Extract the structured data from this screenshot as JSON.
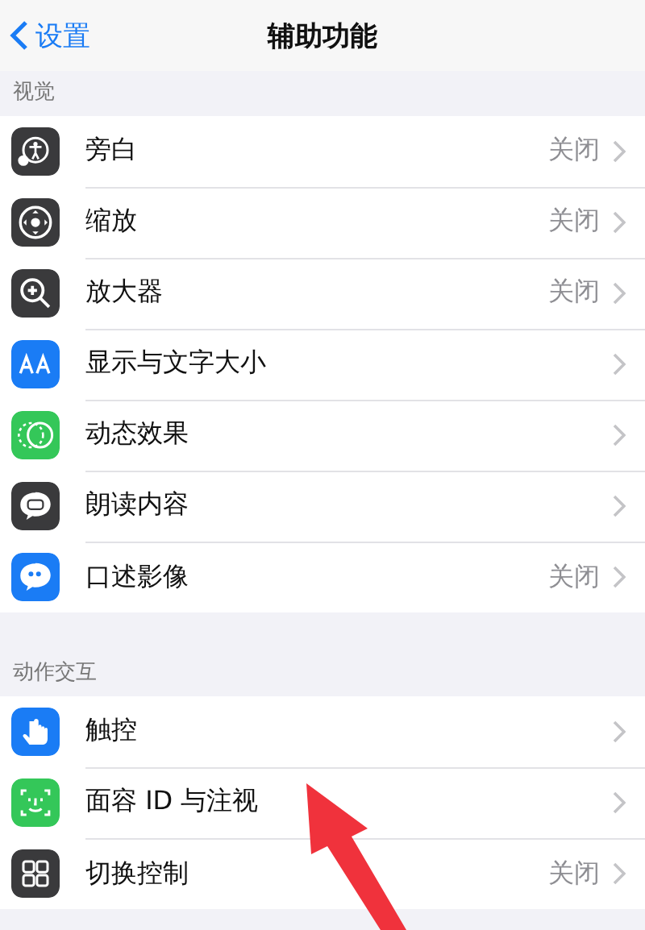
{
  "nav": {
    "back": "设置",
    "title": "辅助功能"
  },
  "sections": [
    {
      "header": "视觉",
      "rows": [
        {
          "kind": "voiceover",
          "label": "旁白",
          "value": "关闭"
        },
        {
          "kind": "zoom",
          "label": "缩放",
          "value": "关闭"
        },
        {
          "kind": "magnifier",
          "label": "放大器",
          "value": "关闭"
        },
        {
          "kind": "text",
          "label": "显示与文字大小"
        },
        {
          "kind": "motion",
          "label": "动态效果"
        },
        {
          "kind": "speech",
          "label": "朗读内容"
        },
        {
          "kind": "audiodesc",
          "label": "口述影像",
          "value": "关闭"
        }
      ]
    },
    {
      "header": "动作交互",
      "rows": [
        {
          "kind": "touch",
          "label": "触控"
        },
        {
          "kind": "faceid",
          "label": "面容 ID 与注视"
        },
        {
          "kind": "switch",
          "label": "切换控制",
          "value": "关闭"
        }
      ]
    }
  ],
  "annotation": {
    "kind": "arrow"
  }
}
